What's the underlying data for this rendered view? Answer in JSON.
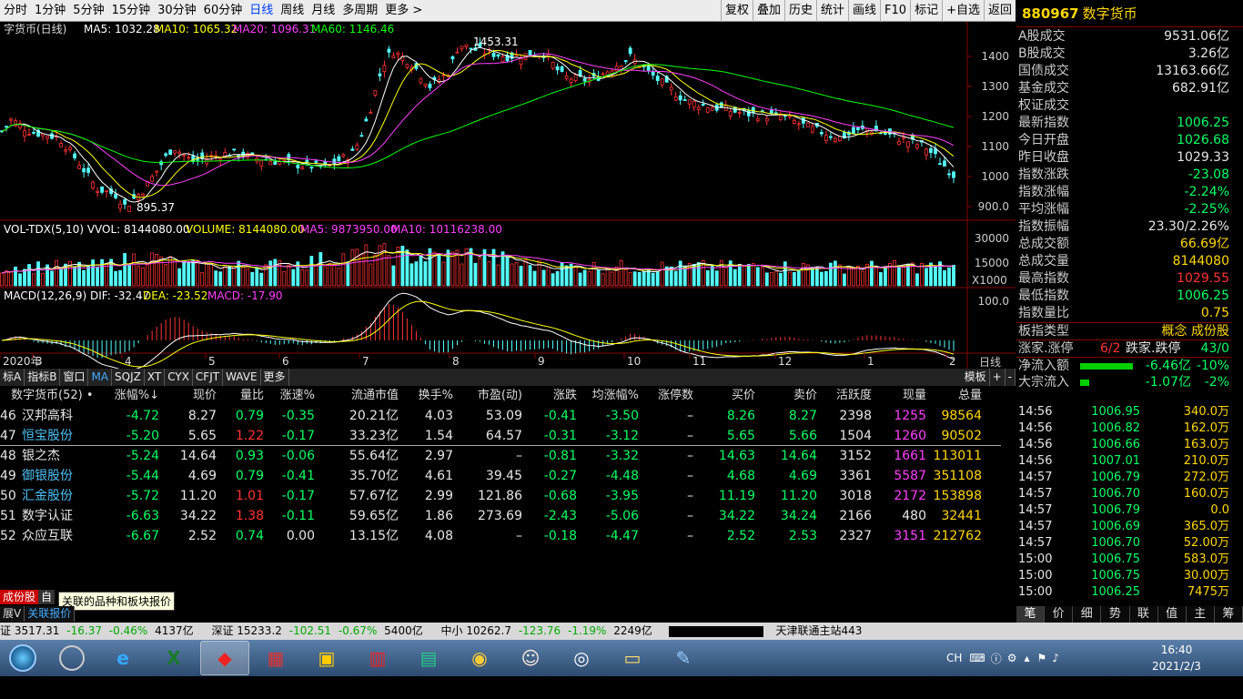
{
  "toolbar": {
    "periods": [
      "分时",
      "1分钟",
      "5分钟",
      "15分钟",
      "30分钟",
      "60分钟",
      "日线",
      "周线",
      "月线",
      "多周期",
      "更多 >"
    ],
    "active": "日线",
    "right": [
      "复权",
      "叠加",
      "历史",
      "统计",
      "画线",
      "F10",
      "标记",
      "+自选",
      "返回"
    ]
  },
  "header": {
    "code": "880967",
    "name": "数字货币"
  },
  "legend": {
    "main": "字货币(日线)",
    "ma5": "MA5: 1032.28",
    "ma10": "MA10: 1065.32",
    "ma20": "MA20: 1096.31",
    "ma60": "MA60: 1146.46",
    "vol": "VOL-TDX(5,10)  VVOL: 8144080.00",
    "volume": "VOLUME: 8144080.00",
    "vma5": "MA5: 9873950.00",
    "vma10": "MA10: 10116238.00",
    "macd": "MACD(12,26,9)  DIF: -32.47",
    "dea": "DEA: -23.52",
    "macdv": "MACD: -17.90",
    "high": "1453.31",
    "low": "895.37",
    "volunit": "X1000"
  },
  "axis": {
    "price": [
      "1400",
      "1300",
      "1200",
      "1100",
      "1000",
      "900.0"
    ],
    "vol": [
      "30000",
      "15000"
    ],
    "macd": [
      "100.0"
    ],
    "dates": [
      "2020年",
      "3",
      "4",
      "5",
      "6",
      "7",
      "8",
      "9",
      "10",
      "11",
      "12",
      "1",
      "2"
    ],
    "period": "日线"
  },
  "bottom_tabs": {
    "items": [
      "标A",
      "指标B",
      "窗口",
      "MA",
      "SQJZ",
      "XT",
      "CYX",
      "CFJT",
      "WAVE",
      "更多"
    ],
    "right": [
      "模板",
      "+",
      "-"
    ]
  },
  "table": {
    "headers": [
      "数字货币(52) •",
      "涨幅%↓",
      "现价",
      "量比",
      "涨速%",
      "流通市值",
      "换手%",
      "市盈(动)",
      "涨跌",
      "均涨幅%",
      "涨停数",
      "买价",
      "卖价",
      "活跃度",
      "现量",
      "总量"
    ],
    "rows": [
      [
        "46",
        "汉邦高科",
        "-4.72",
        "8.27",
        "0.79",
        "-0.35",
        "20.21亿",
        "4.03",
        "53.09",
        "-0.41",
        "-3.50",
        "–",
        "8.26",
        "8.27",
        "2398",
        "1255",
        "98564"
      ],
      [
        "47",
        "恒宝股份",
        "-5.20",
        "5.65",
        "1.22",
        "-0.17",
        "33.23亿",
        "1.54",
        "64.57",
        "-0.31",
        "-3.12",
        "–",
        "5.65",
        "5.66",
        "1504",
        "1260",
        "90502"
      ],
      [
        "48",
        "银之杰",
        "-5.24",
        "14.64",
        "0.93",
        "-0.06",
        "55.64亿",
        "2.97",
        "–",
        "-0.81",
        "-3.32",
        "–",
        "14.63",
        "14.64",
        "3152",
        "1661",
        "113011"
      ],
      [
        "49",
        "御银股份",
        "-5.44",
        "4.69",
        "0.79",
        "-0.41",
        "35.70亿",
        "4.61",
        "39.45",
        "-0.27",
        "-4.48",
        "–",
        "4.68",
        "4.69",
        "3361",
        "5587",
        "351108"
      ],
      [
        "50",
        "汇金股份",
        "-5.72",
        "11.20",
        "1.01",
        "-0.17",
        "57.67亿",
        "2.99",
        "121.86",
        "-0.68",
        "-3.95",
        "–",
        "11.19",
        "11.20",
        "3018",
        "2172",
        "153898"
      ],
      [
        "51",
        "数字认证",
        "-6.63",
        "34.22",
        "1.38",
        "-0.11",
        "59.65亿",
        "1.86",
        "273.69",
        "-2.43",
        "-5.06",
        "–",
        "34.22",
        "34.24",
        "2166",
        "480",
        "32441"
      ],
      [
        "52",
        "众应互联",
        "-6.67",
        "2.52",
        "0.74",
        "0.00",
        "13.15亿",
        "4.08",
        "–",
        "-0.18",
        "-4.47",
        "–",
        "2.52",
        "2.53",
        "2327",
        "3151",
        "212762"
      ]
    ]
  },
  "info": [
    [
      "A股成交",
      "9531.06亿",
      "w"
    ],
    [
      "B股成交",
      "3.26亿",
      "w"
    ],
    [
      "国债成交",
      "13163.66亿",
      "w"
    ],
    [
      "基金成交",
      "682.91亿",
      "w"
    ],
    [
      "权证成交",
      "",
      "w"
    ],
    [
      "最新指数",
      "1006.25",
      "g"
    ],
    [
      "今日开盘",
      "1026.68",
      "g"
    ],
    [
      "昨日收盘",
      "1029.33",
      "w"
    ],
    [
      "指数涨跌",
      "-23.08",
      "g"
    ],
    [
      "指数涨幅",
      "-2.24%",
      "g"
    ],
    [
      "平均涨幅",
      "-2.25%",
      "g"
    ],
    [
      "指数振幅",
      "23.30/2.26%",
      "w"
    ],
    [
      "总成交额",
      "66.69亿",
      "y"
    ],
    [
      "总成交量",
      "8144080",
      "y"
    ],
    [
      "最高指数",
      "1029.55",
      "rd"
    ],
    [
      "最低指数",
      "1006.25",
      "g"
    ],
    [
      "指数量比",
      "0.75",
      "y"
    ]
  ],
  "board": {
    "label": "板指类型",
    "value": "概念 成份股",
    "rise": "涨家.涨停",
    "rise_v": "6/2",
    "fall": "跌家.跌停",
    "fall_v": "43/0",
    "inflow": "净流入额",
    "inflow_v": "-6.46亿",
    "inflow_p": "-10%",
    "big": "大宗流入",
    "big_v": "-1.07亿",
    "big_p": "-2%"
  },
  "ticks": [
    [
      "14:56",
      "1006.95",
      "340.0万"
    ],
    [
      "14:56",
      "1006.82",
      "162.0万"
    ],
    [
      "14:56",
      "1006.66",
      "163.0万"
    ],
    [
      "14:56",
      "1007.01",
      "210.0万"
    ],
    [
      "14:57",
      "1006.79",
      "272.0万"
    ],
    [
      "14:57",
      "1006.70",
      "160.0万"
    ],
    [
      "14:57",
      "1006.79",
      "0.0"
    ],
    [
      "14:57",
      "1006.69",
      "365.0万"
    ],
    [
      "14:57",
      "1006.70",
      "52.00万"
    ],
    [
      "15:00",
      "1006.75",
      "583.0万"
    ],
    [
      "15:00",
      "1006.75",
      "30.00万"
    ],
    [
      "15:00",
      "1006.25",
      "7475万"
    ]
  ],
  "right_tabs": [
    "笔",
    "价",
    "细",
    "势",
    "联",
    "值",
    "主",
    "筹"
  ],
  "left_tabs": {
    "a": "成份股",
    "b": "自",
    "sub1": "展V",
    "sub2": "关联报价"
  },
  "tooltip": "关联的品种和板块报价",
  "status": {
    "sh": "证 3517.31",
    "sh_chg": "-16.37",
    "sh_pct": "-0.46%",
    "sh_amt": "4137亿",
    "sz": "深证 15233.2",
    "sz_chg": "-102.51",
    "sz_pct": "-0.67%",
    "sz_amt": "5400亿",
    "zx": "中小 10262.7",
    "zx_chg": "-123.76",
    "zx_pct": "-1.19%",
    "zx_amt": "2249亿",
    "server": "天津联通主站443"
  },
  "clock": {
    "time": "16:40",
    "date": "2021/2/3"
  },
  "tray": {
    "lang": "CH"
  }
}
